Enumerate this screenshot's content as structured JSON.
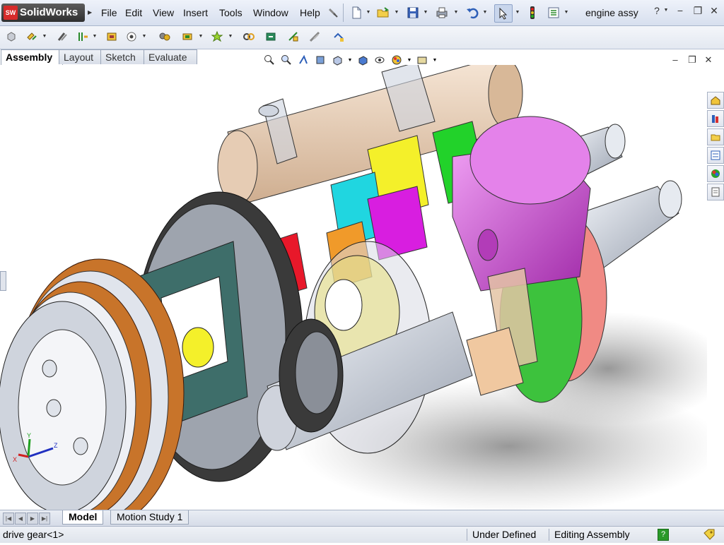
{
  "app": {
    "logo_text": "SolidWorks",
    "logo_badge": "SW",
    "document_title": "engine assy"
  },
  "menu": {
    "items": [
      "File",
      "Edit",
      "View",
      "Insert",
      "Tools",
      "Window",
      "Help"
    ]
  },
  "command_tabs": [
    "Assembly",
    "Layout",
    "Sketch",
    "Evaluate"
  ],
  "bottom_tabs": [
    "Model",
    "Motion Study 1"
  ],
  "status": {
    "selection": "drive gear<1>",
    "definition_state": "Under Defined",
    "mode": "Editing Assembly",
    "help_badge": "?"
  },
  "window_controls": {
    "help": "?",
    "minimize": "−",
    "restore": "❐",
    "close": "✕"
  },
  "viewport_controls": {
    "minimize": "–",
    "restore": "❐",
    "close": "✕"
  },
  "triad": {
    "x": "X",
    "y": "Y",
    "z": "Z"
  },
  "colors": {
    "accent": "#3a6ea5",
    "logo_red": "#d62b2b",
    "gear_red": "#e8182a",
    "gear_pink": "#d81ee0",
    "gear_cyan": "#20d6e0",
    "gear_yellow": "#f4f02a",
    "gear_green": "#22d22a",
    "gear_orange": "#f09a2a",
    "clutch_brown": "#c8742a",
    "piston_magenta": "#d25ad8",
    "tube_tan": "#e6ccb4",
    "salmon": "#f08a84",
    "teal": "#3e6e6a"
  },
  "icons": {
    "toolbar": [
      "new-document-icon",
      "open-folder-icon",
      "save-icon",
      "print-icon",
      "undo-icon",
      "select-arrow-icon",
      "rebuild-traffic-light-icon",
      "options-icon"
    ],
    "command": [
      "insert-components-icon",
      "mate-icon",
      "linear-pattern-icon",
      "smart-fasteners-icon",
      "move-component-icon",
      "show-hidden-icon",
      "assembly-features-icon",
      "reference-geometry-icon",
      "new-motion-study-icon",
      "bill-of-materials-icon",
      "exploded-view-icon",
      "explode-line-sketch-icon",
      "interference-detection-icon"
    ],
    "headsup": [
      "zoom-to-fit-icon",
      "zoom-area-icon",
      "previous-view-icon",
      "section-view-icon",
      "view-orientation-icon",
      "display-style-icon",
      "hide-show-icon",
      "edit-appearance-icon",
      "apply-scene-icon",
      "view-settings-icon"
    ],
    "taskpane": [
      "home-icon",
      "design-library-icon",
      "file-explorer-icon",
      "view-palette-icon",
      "appearances-icon",
      "custom-properties-icon"
    ]
  }
}
